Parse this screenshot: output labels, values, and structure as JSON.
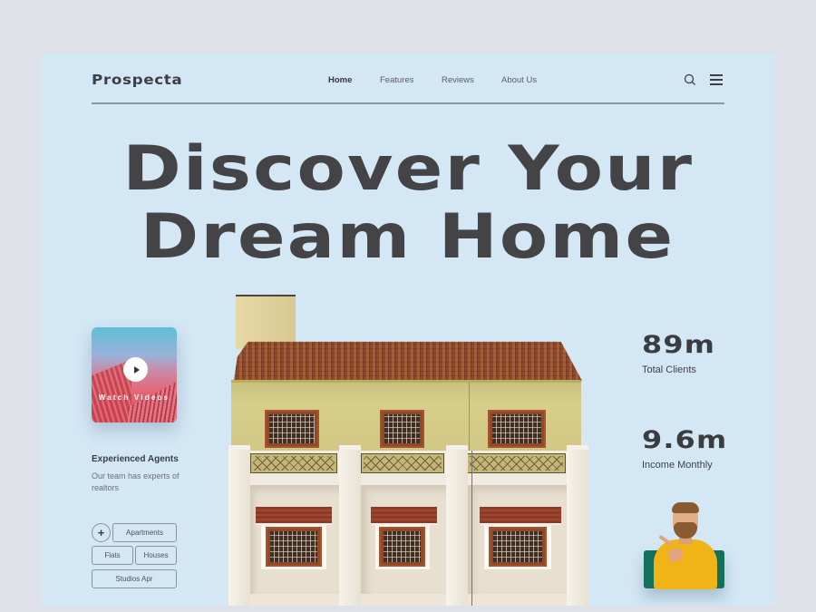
{
  "brand": {
    "logo": "Prospecta"
  },
  "nav": {
    "items": [
      {
        "label": "Home",
        "active": true
      },
      {
        "label": "Features",
        "active": false
      },
      {
        "label": "Reviews",
        "active": false
      },
      {
        "label": "About Us",
        "active": false
      }
    ],
    "icons": [
      "search-icon",
      "menu-icon"
    ]
  },
  "hero": {
    "line1": "Discover Your",
    "line2": "Dream Home"
  },
  "video": {
    "label": "Watch Videos",
    "icon": "play-icon"
  },
  "agents": {
    "title": "Experienced Agents",
    "description": "Our team has experts of realtors"
  },
  "tags": {
    "add_icon": "+",
    "items": [
      "Apartments",
      "Flats",
      "Houses",
      "Studios Apr"
    ]
  },
  "stats": [
    {
      "value": "89m",
      "label": "Total Clients"
    },
    {
      "value": "9.6m",
      "label": "Income Monthly"
    }
  ],
  "colors": {
    "page_background": "#dfe1e8",
    "card_background": "#d3e7f5",
    "heading_text": "#444446",
    "accent_green": "#127158",
    "agent_sweater": "#f1b416"
  }
}
